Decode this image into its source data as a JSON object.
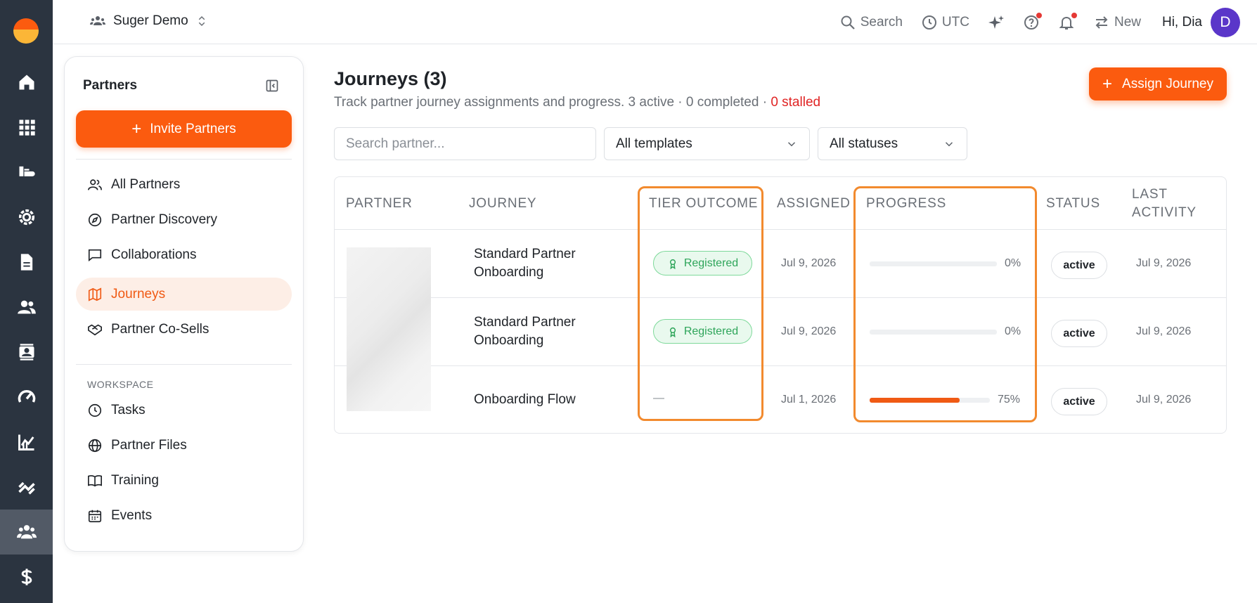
{
  "colors": {
    "accent": "#fb5b0f",
    "rail_bg": "#2b3440",
    "stalled": "#e02424",
    "highlight": "#f28a2e"
  },
  "topbar": {
    "org_name": "Suger Demo",
    "search_label": "Search",
    "timezone_label": "UTC",
    "new_label": "New",
    "greeting": "Hi, Dia",
    "avatar_initial": "D"
  },
  "rail": {
    "items": [
      "home-icon",
      "grid-icon",
      "listings-icon",
      "settings-icon",
      "document-icon",
      "users-icon",
      "contacts-icon",
      "gauge-icon",
      "analytics-icon",
      "integrations-icon",
      "partners-icon",
      "dollar-icon"
    ],
    "active": "partners-icon"
  },
  "sidebar": {
    "title": "Partners",
    "invite_label": "Invite Partners",
    "items": [
      {
        "label": "All Partners",
        "icon": "users-icon"
      },
      {
        "label": "Partner Discovery",
        "icon": "compass-icon"
      },
      {
        "label": "Collaborations",
        "icon": "chat-icon"
      },
      {
        "label": "Journeys",
        "icon": "map-icon",
        "active": true
      },
      {
        "label": "Partner Co-Sells",
        "icon": "handshake-icon"
      }
    ],
    "workspace_label": "WORKSPACE",
    "workspace_items": [
      {
        "label": "Tasks",
        "icon": "clock-icon"
      },
      {
        "label": "Partner Files",
        "icon": "globe-icon"
      },
      {
        "label": "Training",
        "icon": "book-icon"
      },
      {
        "label": "Events",
        "icon": "calendar-icon"
      }
    ]
  },
  "main": {
    "title": "Journeys (3)",
    "subtitle": "Track partner journey assignments and progress. 3 active · 0 completed · ",
    "subtitle_stalled": "0 stalled",
    "assign_label": "Assign Journey",
    "search_placeholder": "Search partner...",
    "template_filter": "All templates",
    "status_filter": "All statuses",
    "columns": {
      "partner": "PARTNER",
      "journey": "JOURNEY",
      "tier": "TIER OUTCOME",
      "assigned": "ASSIGNED",
      "progress": "PROGRESS",
      "status": "STATUS",
      "last_activity_1": "LAST",
      "last_activity_2": "ACTIVITY"
    },
    "rows": [
      {
        "journey_1": "Standard Partner",
        "journey_2": "Onboarding",
        "tier": "Registered",
        "assigned": "Jul 9, 2026",
        "progress": 0,
        "progress_label": "0%",
        "status": "active",
        "last_activity": "Jul 9, 2026"
      },
      {
        "journey_1": "Standard Partner",
        "journey_2": "Onboarding",
        "tier": "Registered",
        "assigned": "Jul 9, 2026",
        "progress": 0,
        "progress_label": "0%",
        "status": "active",
        "last_activity": "Jul 9, 2026"
      },
      {
        "journey_1": "Onboarding Flow",
        "journey_2": "",
        "tier": "—",
        "assigned": "Jul 1, 2026",
        "progress": 75,
        "progress_label": "75%",
        "status": "active",
        "last_activity": "Jul 9, 2026"
      }
    ]
  }
}
